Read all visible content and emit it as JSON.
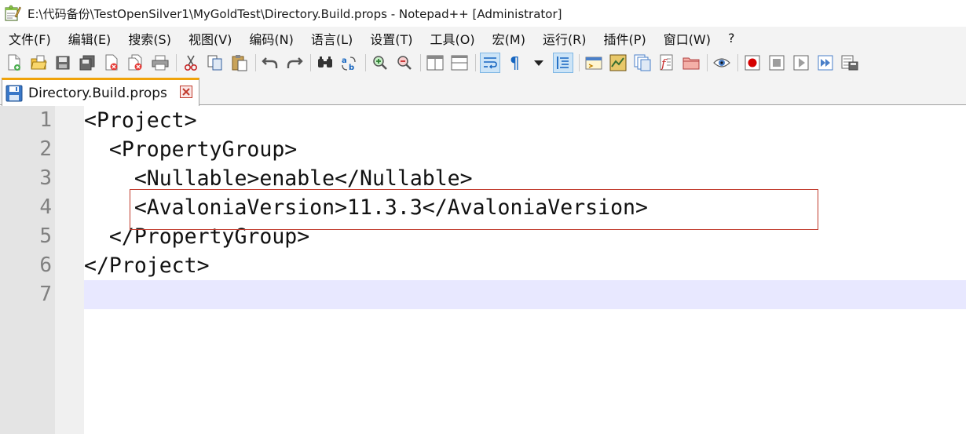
{
  "window": {
    "title": "E:\\代码备份\\TestOpenSilver1\\MyGoldTest\\Directory.Build.props - Notepad++ [Administrator]",
    "app_icon": "notepad-plus-plus-icon"
  },
  "menu": {
    "items": [
      {
        "label": "文件(F)"
      },
      {
        "label": "编辑(E)"
      },
      {
        "label": "搜索(S)"
      },
      {
        "label": "视图(V)"
      },
      {
        "label": "编码(N)"
      },
      {
        "label": "语言(L)"
      },
      {
        "label": "设置(T)"
      },
      {
        "label": "工具(O)"
      },
      {
        "label": "宏(M)"
      },
      {
        "label": "运行(R)"
      },
      {
        "label": "插件(P)"
      },
      {
        "label": "窗口(W)"
      },
      {
        "label": "?"
      }
    ]
  },
  "toolbar": {
    "icons": [
      "new-file-icon",
      "open-file-icon",
      "save-icon",
      "save-all-icon",
      "close-icon",
      "close-all-icon",
      "print-icon",
      "cut-icon",
      "copy-icon",
      "paste-icon",
      "undo-icon",
      "redo-icon",
      "find-icon",
      "replace-icon",
      "zoom-in-icon",
      "zoom-out-icon",
      "sync-vertical-icon",
      "sync-horizontal-icon",
      "word-wrap-icon",
      "show-all-chars-icon",
      "dropdown-arrow-icon",
      "indent-guide-icon",
      "udl-icon",
      "doc-map-icon",
      "doc-list-icon",
      "function-list-icon",
      "folder-workspace-icon",
      "monitoring-icon",
      "record-macro-icon",
      "stop-record-icon",
      "play-macro-icon",
      "run-macro-multiple-icon",
      "save-macro-icon"
    ]
  },
  "tab": {
    "label": "Directory.Build.props",
    "save_icon": "save-icon",
    "close_icon": "close-icon"
  },
  "editor": {
    "current_line": 7,
    "lines": [
      {
        "num": "1",
        "text": "<Project>"
      },
      {
        "num": "2",
        "text": "  <PropertyGroup>"
      },
      {
        "num": "3",
        "text": "    <Nullable>enable</Nullable>"
      },
      {
        "num": "4",
        "text": "    <AvaloniaVersion>11.3.3</AvaloniaVersion>"
      },
      {
        "num": "5",
        "text": "  </PropertyGroup>"
      },
      {
        "num": "6",
        "text": "</Project>"
      },
      {
        "num": "7",
        "text": ""
      }
    ],
    "highlighted_line": 4,
    "highlight_color": "#c0392b"
  }
}
